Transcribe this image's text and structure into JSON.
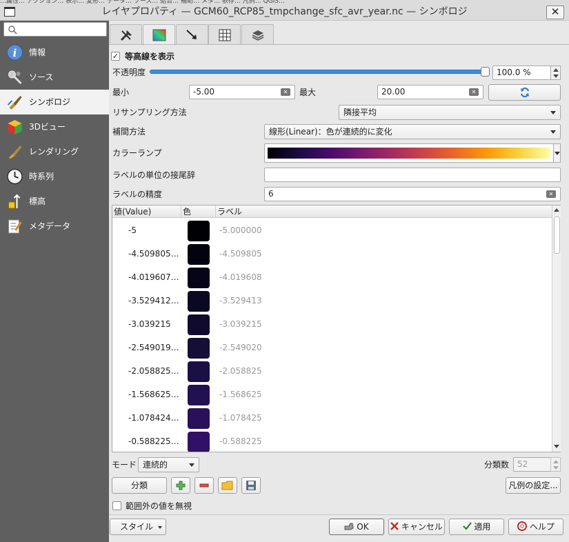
{
  "window": {
    "title": "レイヤプロパティ — GCM60_RCP85_tmpchange_sfc_avr_year.nc — シンボロジ",
    "top_strip_text": "…属性… アクション… 表示… 変形… データ… ソース… 結合… 補助… メタ… 依存… 凡例… QGIS…",
    "close_label": "✕"
  },
  "sidebar": {
    "search_placeholder": "",
    "items": [
      {
        "label": "情報",
        "icon": "info-icon"
      },
      {
        "label": "ソース",
        "icon": "source-wrench-icon"
      },
      {
        "label": "シンボロジ",
        "icon": "paintbrush-icon"
      },
      {
        "label": "3Dビュー",
        "icon": "cube-3d-icon"
      },
      {
        "label": "レンダリング",
        "icon": "brush-icon"
      },
      {
        "label": "時系列",
        "icon": "clock-icon"
      },
      {
        "label": "標高",
        "icon": "elevation-icon"
      },
      {
        "label": "メタデータ",
        "icon": "metadata-icon"
      }
    ],
    "selected_index": 2
  },
  "tabs": [
    {
      "icon": "tools-icon"
    },
    {
      "icon": "color-gradient-icon"
    },
    {
      "icon": "arrow-icon"
    },
    {
      "icon": "grid-icon"
    },
    {
      "icon": "stack-icon"
    }
  ],
  "symbology": {
    "show_contours_label": "等高線を表示",
    "show_contours_checked": true,
    "opacity_label": "不透明度",
    "opacity_value": "100.0 %",
    "opacity_fraction": 1.0,
    "min_label": "最小",
    "min_value": "-5.00",
    "max_label": "最大",
    "max_value": "20.00",
    "resampling_label": "リサンプリング方法",
    "resampling_value": "隣接平均",
    "interpolation_label": "補間方法",
    "interpolation_value": "線形(Linear)：色が連続的に変化",
    "color_ramp_label": "カラーランプ",
    "unit_suffix_label": "ラベルの単位の接尾辞",
    "unit_suffix_value": "",
    "precision_label": "ラベルの精度",
    "precision_value": "6"
  },
  "table": {
    "headers": [
      "値(Value)",
      "色",
      "ラベル"
    ],
    "rows": [
      {
        "value": "-5",
        "color": "#000004",
        "label": "-5.000000"
      },
      {
        "value": "-4.509805…",
        "color": "#03030f",
        "label": "-4.509805"
      },
      {
        "value": "-4.019607…",
        "color": "#050418",
        "label": "-4.019608"
      },
      {
        "value": "-3.529412…",
        "color": "#0a0822",
        "label": "-3.529413"
      },
      {
        "value": "-3.039215",
        "color": "#100b2d",
        "label": "-3.039215"
      },
      {
        "value": "-2.549019…",
        "color": "#150e37",
        "label": "-2.549020"
      },
      {
        "value": "-2.058825…",
        "color": "#1b1044",
        "label": "-2.058825"
      },
      {
        "value": "-1.568625…",
        "color": "#221150",
        "label": "-1.568625"
      },
      {
        "value": "-1.078424…",
        "color": "#29115a",
        "label": "-1.078425"
      },
      {
        "value": "-0.588225…",
        "color": "#301165",
        "label": "-0.588225"
      }
    ]
  },
  "mode": {
    "label": "モード",
    "value": "連続的",
    "classes_label": "分類数",
    "classes_value": "52"
  },
  "actions": {
    "classify_label": "分類",
    "legend_settings_label": "凡例の設定...",
    "ignore_out_of_range_label": "範囲外の値を無視",
    "ignore_out_of_range_checked": false
  },
  "footer": {
    "style_label": "スタイル",
    "ok_label": "OK",
    "cancel_label": "キャンセル",
    "apply_label": "適用",
    "help_label": "ヘルプ"
  },
  "colors": {
    "ramp": [
      "#000004",
      "#1b0c41",
      "#4a0c6b",
      "#781c6d",
      "#a52c60",
      "#cf4446",
      "#ed6925",
      "#fb9b06",
      "#f7d13d",
      "#fcffa4"
    ],
    "accent": "#3d8ee0",
    "sidebar_bg": "#5f5f5f"
  }
}
